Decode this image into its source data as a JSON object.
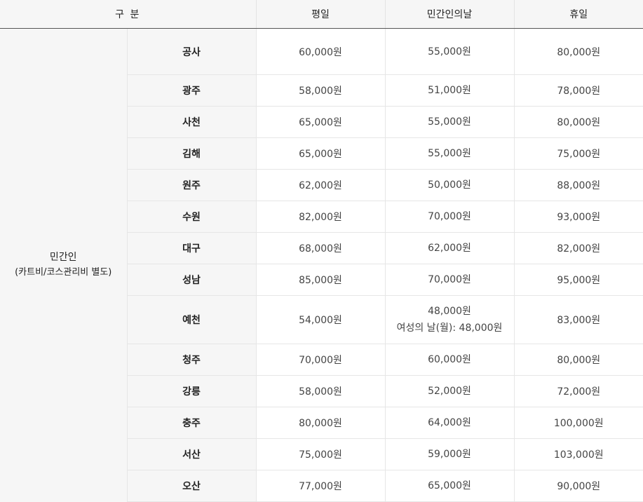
{
  "header": {
    "category": "구 분",
    "weekday": "평일",
    "civilian_day": "민간인의날",
    "holiday": "휴일"
  },
  "category": {
    "title": "민간인",
    "subtitle": "(카트비/코스관리비 별도)"
  },
  "rows": [
    {
      "location": "공사",
      "weekday": "60,000원",
      "civilian_day": [
        "55,000원"
      ],
      "holiday": "80,000원"
    },
    {
      "location": "광주",
      "weekday": "58,000원",
      "civilian_day": [
        "51,000원"
      ],
      "holiday": "78,000원"
    },
    {
      "location": "사천",
      "weekday": "65,000원",
      "civilian_day": [
        "55,000원"
      ],
      "holiday": "80,000원"
    },
    {
      "location": "김해",
      "weekday": "65,000원",
      "civilian_day": [
        "55,000원"
      ],
      "holiday": "75,000원"
    },
    {
      "location": "원주",
      "weekday": "62,000원",
      "civilian_day": [
        "50,000원"
      ],
      "holiday": "88,000원"
    },
    {
      "location": "수원",
      "weekday": "82,000원",
      "civilian_day": [
        "70,000원"
      ],
      "holiday": "93,000원"
    },
    {
      "location": "대구",
      "weekday": "68,000원",
      "civilian_day": [
        "62,000원"
      ],
      "holiday": "82,000원"
    },
    {
      "location": "성남",
      "weekday": "85,000원",
      "civilian_day": [
        "70,000원"
      ],
      "holiday": "95,000원"
    },
    {
      "location": "예천",
      "weekday": "54,000원",
      "civilian_day": [
        "48,000원",
        "여성의 날(월): 48,000원"
      ],
      "holiday": "83,000원"
    },
    {
      "location": "청주",
      "weekday": "70,000원",
      "civilian_day": [
        "60,000원"
      ],
      "holiday": "80,000원"
    },
    {
      "location": "강릉",
      "weekday": "58,000원",
      "civilian_day": [
        "52,000원"
      ],
      "holiday": "72,000원"
    },
    {
      "location": "충주",
      "weekday": "80,000원",
      "civilian_day": [
        "64,000원"
      ],
      "holiday": "100,000원"
    },
    {
      "location": "서산",
      "weekday": "75,000원",
      "civilian_day": [
        "59,000원"
      ],
      "holiday": "103,000원"
    },
    {
      "location": "오산",
      "weekday": "77,000원",
      "civilian_day": [
        "65,000원"
      ],
      "holiday": "90,000원"
    }
  ]
}
